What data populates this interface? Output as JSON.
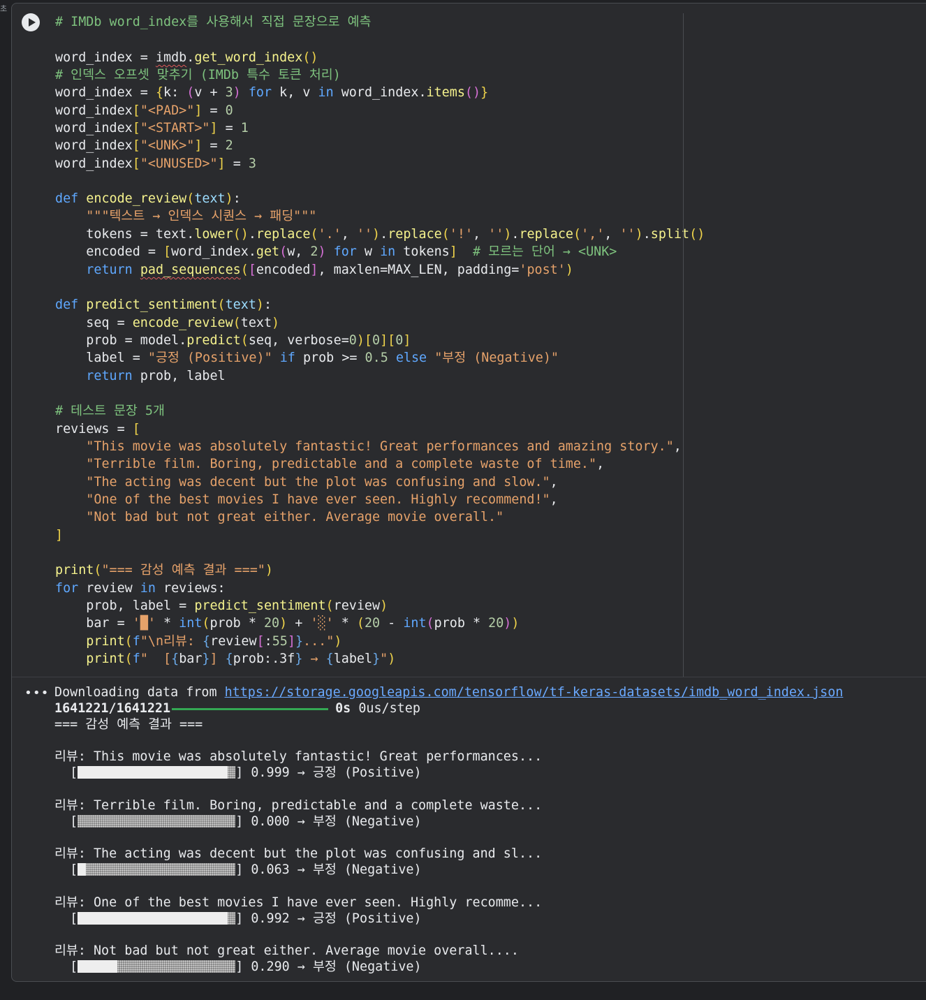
{
  "gutter": {
    "mark": "초"
  },
  "code": {
    "c_title": "# IMDb word_index를 사용해서 직접 문장으로 예측",
    "c_offset": "# 인덱스 오프셋 맞추기 (IMDb 특수 토큰 처리)",
    "doc_encode": "\"\"\"텍스트 → 인덱스 시퀀스 → 패딩\"\"\"",
    "c_unk": "# 모르는 단어 → <UNK>",
    "s_pos": "\"긍정 (Positive)\"",
    "s_neg": "\"부정 (Negative)\"",
    "c_reviews": "# 테스트 문장 5개",
    "review_1": "\"This movie was absolutely fantastic! Great performances and amazing story.\"",
    "review_2": "\"Terrible film. Boring, predictable and a complete waste of time.\"",
    "review_3": "\"The acting was decent but the plot was confusing and slow.\"",
    "review_4": "\"One of the best movies I have ever seen. Highly recommend!\"",
    "review_5": "\"Not bad but not great either. Average movie overall.\"",
    "s_header": "\"=== 감성 예측 결과 ===\"",
    "s_review_prefix": "\\n리뷰: ",
    "s_bar_full": "'█'",
    "s_bar_empty": "'░'"
  },
  "output": {
    "download_text": "Downloading data from ",
    "download_url": "https://storage.googleapis.com/tensorflow/tf-keras-datasets/imdb_word_index.json",
    "progress_count": "1641221/1641221",
    "progress_fraction": 1.0,
    "progress_time": "0s",
    "progress_rate": " 0us/step",
    "header": "=== 감성 예측 결과 ===",
    "results": [
      {
        "review": "리뷰: This movie was absolutely fantastic! Great performances...",
        "prob": 0.999,
        "prob_text": "] 0.999 → 긍정 (Positive)"
      },
      {
        "review": "리뷰: Terrible film. Boring, predictable and a complete waste...",
        "prob": 0.0,
        "prob_text": "] 0.000 → 부정 (Negative)"
      },
      {
        "review": "리뷰: The acting was decent but the plot was confusing and sl...",
        "prob": 0.063,
        "prob_text": "] 0.063 → 부정 (Negative)"
      },
      {
        "review": "리뷰: One of the best movies I have ever seen. Highly recomme...",
        "prob": 0.992,
        "prob_text": "] 0.992 → 긍정 (Positive)"
      },
      {
        "review": "리뷰: Not bad but not great either. Average movie overall....",
        "prob": 0.29,
        "prob_text": "] 0.290 → 부정 (Negative)"
      }
    ]
  },
  "icons": {
    "run": "play-icon",
    "menu": "more-horizontal-icon"
  },
  "colors": {
    "background": "#2a2b2e",
    "keyword": "#5fa8ff",
    "string": "#e6a26a",
    "comment": "#7ec27e",
    "link": "#6aa9ff",
    "progress": "#34a853"
  }
}
